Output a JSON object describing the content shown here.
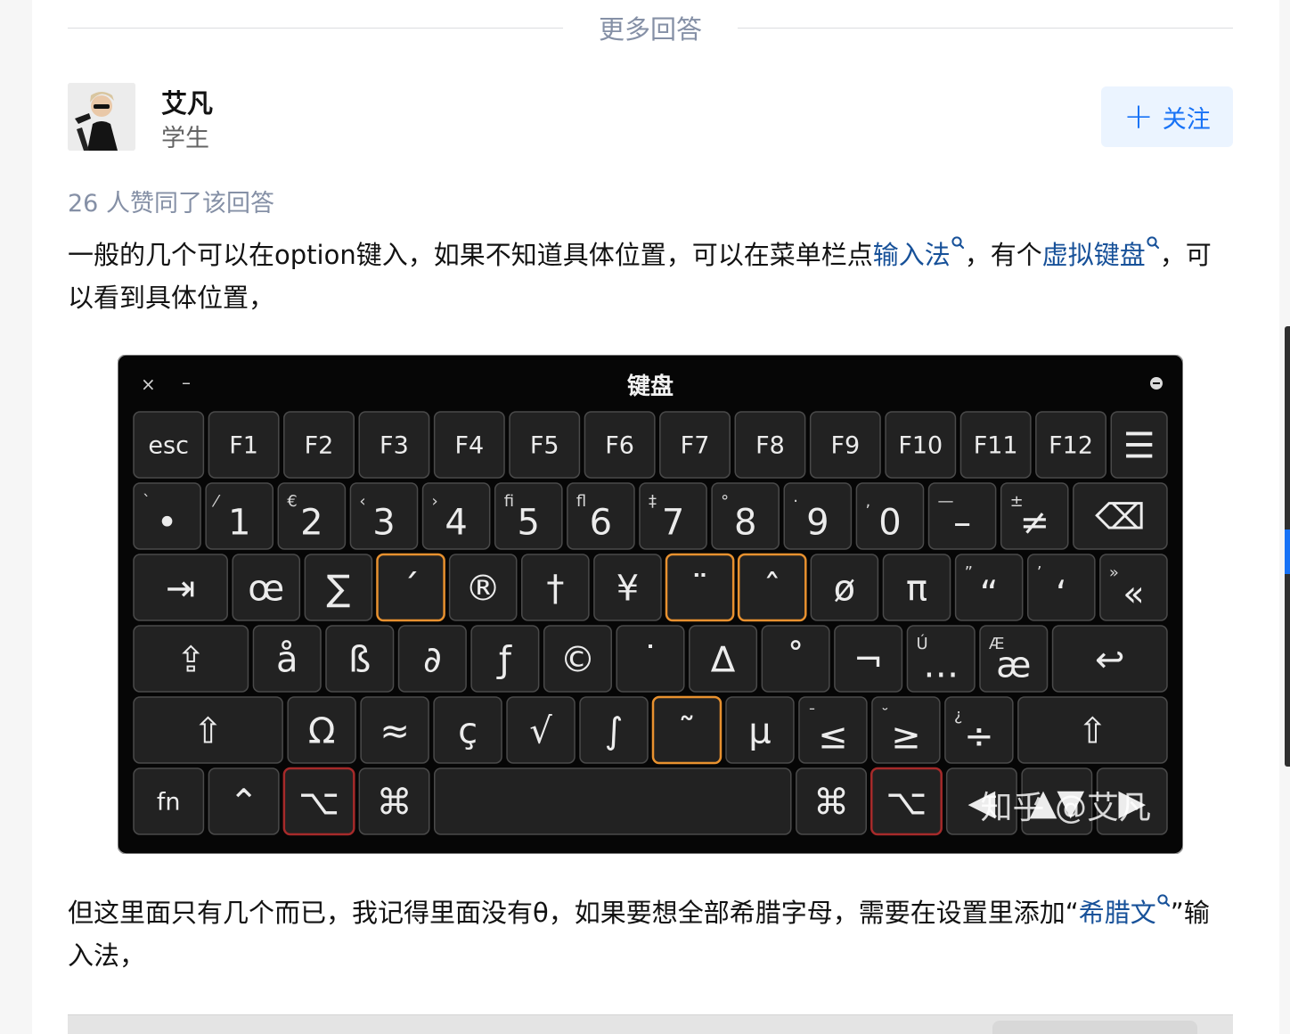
{
  "header": {
    "more_answers": "更多回答"
  },
  "author": {
    "name": "艾凡",
    "title": "学生",
    "follow_label": "关注"
  },
  "answer": {
    "votes": "26 人赞同了该回答",
    "p1_a": "一般的几个可以在option键入，如果不知道具体位置，可以在菜单栏点",
    "p1_link1": "输入法",
    "p1_b": "，有个",
    "p1_link2": "虚拟键盘",
    "p1_c": "，可以看到具体位置，",
    "p2_a": "但这里面只有几个而已，我记得里面没有θ，如果要想全部希腊字母，需要在设置里添加“",
    "p2_link": "希腊文",
    "p2_b": "”输入法，"
  },
  "keyboard": {
    "title": "键盘",
    "watermark": "知乎 @艾凡",
    "close_glyph": "×",
    "min_glyph": "–",
    "rows": [
      [
        {
          "label": "esc",
          "w": 1
        },
        {
          "label": "F1",
          "w": 1
        },
        {
          "label": "F2",
          "w": 1
        },
        {
          "label": "F3",
          "w": 1
        },
        {
          "label": "F4",
          "w": 1
        },
        {
          "label": "F5",
          "w": 1
        },
        {
          "label": "F6",
          "w": 1
        },
        {
          "label": "F7",
          "w": 1
        },
        {
          "label": "F8",
          "w": 1
        },
        {
          "label": "F9",
          "w": 1
        },
        {
          "label": "F10",
          "w": 1
        },
        {
          "label": "F11",
          "w": 1
        },
        {
          "label": "F12",
          "w": 1
        },
        {
          "label": "☰",
          "w": 0.8
        }
      ],
      [
        {
          "label": "•",
          "sup": "`"
        },
        {
          "label": "1",
          "sup": "⁄"
        },
        {
          "label": "2",
          "sup": "€"
        },
        {
          "label": "3",
          "sup": "‹"
        },
        {
          "label": "4",
          "sup": "›"
        },
        {
          "label": "5",
          "sup": "ﬁ"
        },
        {
          "label": "6",
          "sup": "ﬂ"
        },
        {
          "label": "7",
          "sup": "‡"
        },
        {
          "label": "8",
          "sup": "°"
        },
        {
          "label": "9",
          "sup": "·"
        },
        {
          "label": "0",
          "sup": "‚"
        },
        {
          "label": "–",
          "sup": "—"
        },
        {
          "label": "≠",
          "sup": "±"
        },
        {
          "label": "⌫",
          "w": 1.4
        }
      ],
      [
        {
          "label": "⇥",
          "w": 1.4
        },
        {
          "label": "œ"
        },
        {
          "label": "∑"
        },
        {
          "label": "´",
          "hl": "orange"
        },
        {
          "label": "®"
        },
        {
          "label": "†"
        },
        {
          "label": "¥"
        },
        {
          "label": "¨",
          "hl": "orange"
        },
        {
          "label": "ˆ",
          "hl": "orange"
        },
        {
          "label": "ø"
        },
        {
          "label": "π"
        },
        {
          "label": "“",
          "sup": "”"
        },
        {
          "label": "‘",
          "sup": "’"
        },
        {
          "label": "«",
          "sup": "»"
        }
      ],
      [
        {
          "label": "⇪",
          "w": 1.7
        },
        {
          "label": "å"
        },
        {
          "label": "ß"
        },
        {
          "label": "∂"
        },
        {
          "label": "ƒ"
        },
        {
          "label": "©"
        },
        {
          "label": "˙"
        },
        {
          "label": "∆"
        },
        {
          "label": "˚"
        },
        {
          "label": "¬"
        },
        {
          "label": "…",
          "sup": "Ú"
        },
        {
          "label": "æ",
          "sup": "Æ"
        },
        {
          "label": "↩",
          "w": 1.7
        }
      ],
      [
        {
          "label": "⇧",
          "w": 2.2
        },
        {
          "label": "Ω"
        },
        {
          "label": "≈"
        },
        {
          "label": "ç"
        },
        {
          "label": "√"
        },
        {
          "label": "∫"
        },
        {
          "label": "˜",
          "hl": "orange"
        },
        {
          "label": "µ"
        },
        {
          "label": "≤",
          "sup": "¯"
        },
        {
          "label": "≥",
          "sup": "˘"
        },
        {
          "label": "÷",
          "sup": "¿"
        },
        {
          "label": "⇧",
          "w": 2.2
        }
      ],
      [
        {
          "label": "fn"
        },
        {
          "label": "⌃"
        },
        {
          "label": "⌥",
          "hl": "red"
        },
        {
          "label": "⌘"
        },
        {
          "label": "",
          "w": 5.1
        },
        {
          "label": "⌘"
        },
        {
          "label": "⌥",
          "hl": "red"
        },
        {
          "label": "◀",
          "w": 1
        },
        {
          "label": "▲▼",
          "w": 1
        },
        {
          "label": "▶",
          "w": 1
        }
      ]
    ]
  }
}
